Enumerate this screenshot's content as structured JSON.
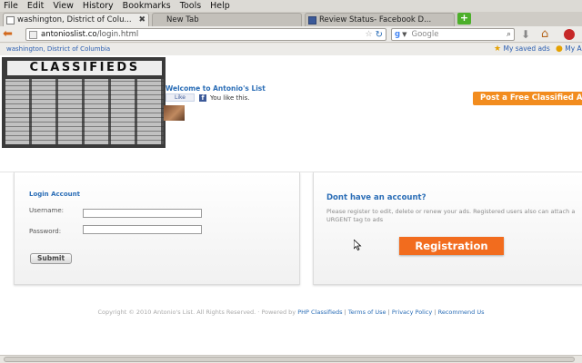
{
  "menu": [
    "File",
    "Edit",
    "View",
    "History",
    "Bookmarks",
    "Tools",
    "Help"
  ],
  "tabs": [
    {
      "label": "washington, District of Colu...",
      "active": true
    },
    {
      "label": "New Tab",
      "active": false
    },
    {
      "label": "Review Status- Facebook D...",
      "active": false
    }
  ],
  "nav": {
    "url_host": "antonioslist.co",
    "url_path": "/login.html",
    "search_placeholder": "Google"
  },
  "bookmarks": {
    "breadcrumb": "washington, District of Columbia",
    "saved_ads": "My saved ads",
    "account": "My A"
  },
  "page": {
    "banner_title": "CLASSIFIEDS",
    "welcome": "Welcome to Antonio's List",
    "like_button": "Like",
    "like_text": "You like this.",
    "post_ad": "Post a Free Classified A",
    "login": {
      "heading": "Login Account",
      "username_label": "Username:",
      "password_label": "Password:",
      "submit": "Submit"
    },
    "register": {
      "heading": "Dont have an account?",
      "description": "Please register to edit, delete or renew your ads. Registered users also can attach a URGENT tag to ads",
      "button": "Registration"
    },
    "footer": {
      "copyright": "Copyright © 2010 Antonio's List. All Rights Reserved. · Powered by",
      "powered_by": "PHP Classifieds",
      "terms": "Terms of Use",
      "privacy": "Privacy Policy",
      "recommend": "Recommend Us"
    }
  },
  "colors": {
    "accent_blue": "#2a6db6",
    "orange_button": "#f26c1e",
    "facebook_blue": "#3b5998"
  }
}
